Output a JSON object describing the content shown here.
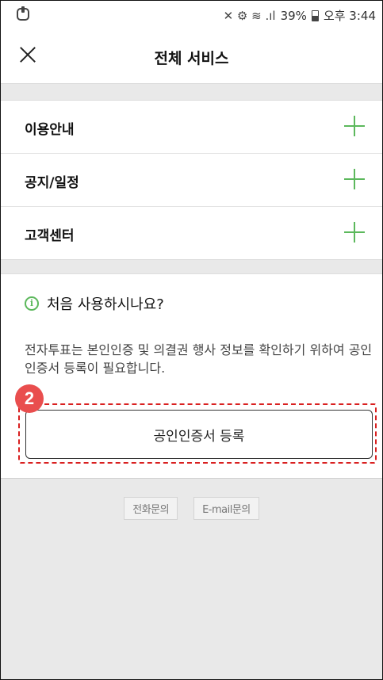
{
  "status_bar": {
    "signal_icons": "✕ ⚙ ≋ .ıl",
    "battery_percent": "39%",
    "time": "오후 3:44"
  },
  "header": {
    "title": "전체 서비스"
  },
  "menu": {
    "items": [
      {
        "label": "이용안내"
      },
      {
        "label": "공지/일정"
      },
      {
        "label": "고객센터"
      }
    ]
  },
  "info": {
    "title": "처음 사용하시나요?",
    "icon_glyph": "i",
    "description": "전자투표는 본인인증 및 의결권 행사 정보를 확인하기 위하여 공인인증서 등록이 필요합니다.",
    "register_button": "공인인증서 등록",
    "step_badge": "2"
  },
  "footer": {
    "phone_inquiry": "전화문의",
    "email_inquiry": "E-mail문의"
  },
  "colors": {
    "accent_green": "#5cb85c",
    "highlight_red": "#d92020",
    "badge_red": "#e94e4e"
  }
}
